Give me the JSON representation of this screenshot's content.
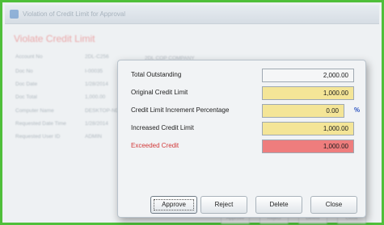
{
  "window": {
    "title": "Violation of Credit Limit for Approval"
  },
  "page": {
    "title": "Violate Credit Limit"
  },
  "background_fields": [
    {
      "label": "Account No",
      "value": "2DL-C256"
    },
    {
      "label": "Doc No",
      "value": "I-00035"
    },
    {
      "label": "Doc Date",
      "value": "1/28/2014"
    },
    {
      "label": "Doc Total",
      "value": "1,000.00"
    },
    {
      "label": "Computer Name",
      "value": "DESKTOP-NDC"
    },
    {
      "label": "Requested Date Time",
      "value": "1/28/2014"
    },
    {
      "label": "Requested User ID",
      "value": "ADMIN"
    }
  ],
  "background_company": "2DL COP COMPANY",
  "background_buttons": [
    "Approve",
    "Reject",
    "Delete",
    "Close"
  ],
  "dialog": {
    "fields": [
      {
        "label": "Total Outstanding",
        "value": "2,000.00",
        "style": "gray"
      },
      {
        "label": "Original Credit Limit",
        "value": "1,000.00",
        "style": "yellow"
      },
      {
        "label": "Credit Limit Increment Percentage",
        "value": "0.00",
        "style": "yellow",
        "suffix": "%"
      },
      {
        "label": "Increased Credit Limit",
        "value": "1,000.00",
        "style": "yellow"
      },
      {
        "label": "Exceeded Credit",
        "value": "1,000.00",
        "style": "red"
      }
    ],
    "buttons": {
      "approve": "Approve",
      "reject": "Reject",
      "delete": "Delete",
      "close": "Close"
    }
  },
  "colors": {
    "window_border": "#4fbf3a",
    "highlight_yellow": "#f4e597",
    "exceeded_red": "#ee7d7d",
    "percent_blue": "#2b53c0"
  }
}
